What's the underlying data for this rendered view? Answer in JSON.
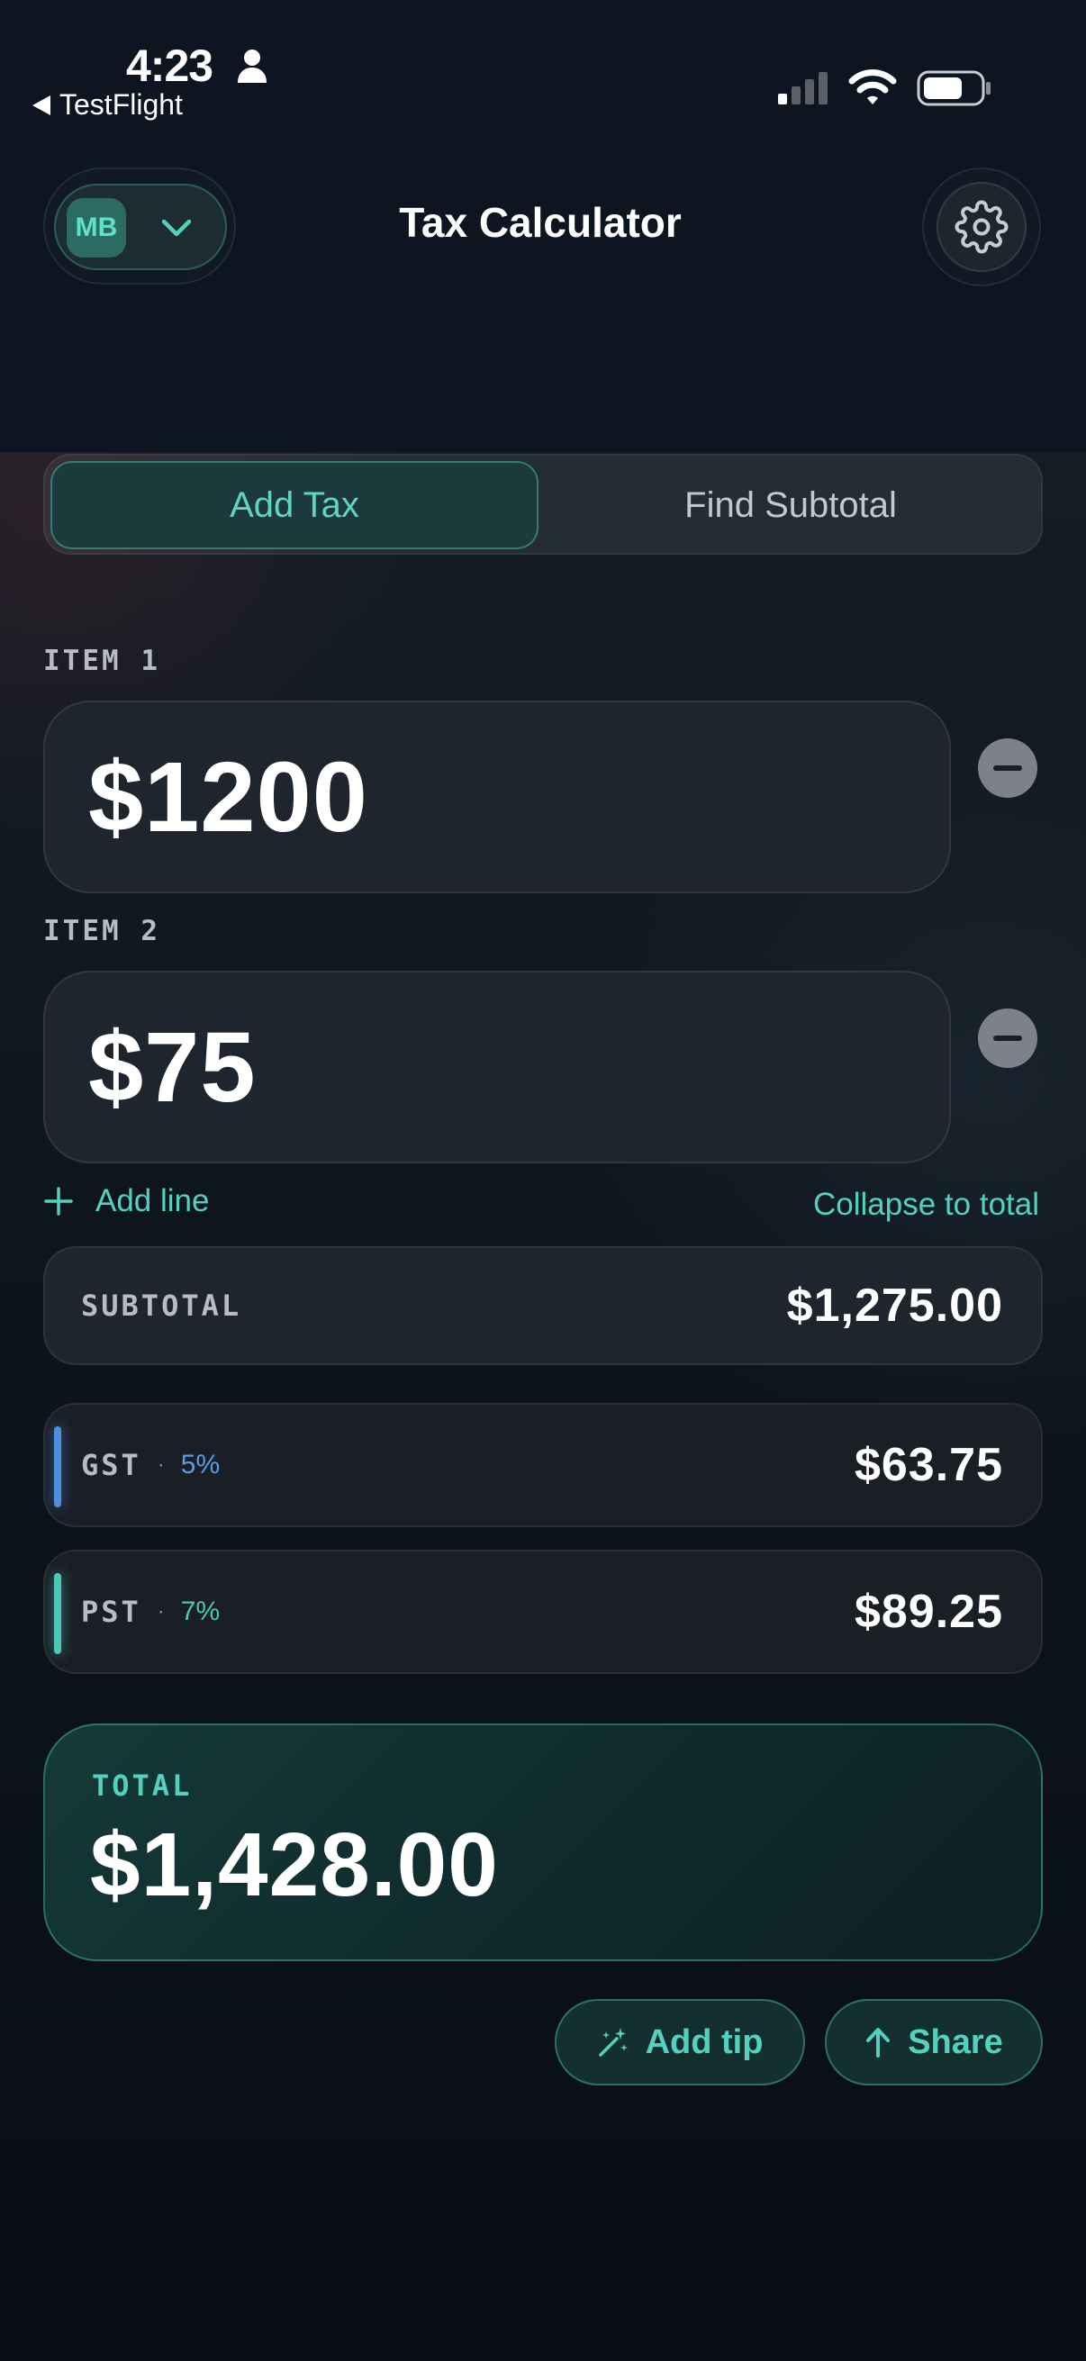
{
  "status_bar": {
    "time": "4:23",
    "back_label": "TestFlight"
  },
  "header": {
    "profile_initials": "MB",
    "title": "Tax Calculator"
  },
  "mode_tabs": [
    {
      "label": "Add Tax",
      "selected": true
    },
    {
      "label": "Find Subtotal",
      "selected": false
    }
  ],
  "items": [
    {
      "label": "ITEM 1",
      "amount": "$1200"
    },
    {
      "label": "ITEM 2",
      "amount": "$75"
    }
  ],
  "actions": {
    "add_line": "Add line",
    "collapse": "Collapse to total"
  },
  "subtotal": {
    "label": "SUBTOTAL",
    "value": "$1,275.00"
  },
  "taxes": [
    {
      "name": "GST",
      "separator": "·",
      "rate": "5%",
      "amount": "$63.75",
      "color": "#4f8fe0"
    },
    {
      "name": "PST",
      "separator": "·",
      "rate": "7%",
      "amount": "$89.25",
      "color": "#4cc8b4"
    }
  ],
  "total": {
    "label": "TOTAL",
    "value": "$1,428.00"
  },
  "buttons": {
    "add_tip": "Add tip",
    "share": "Share"
  },
  "colors": {
    "accent": "#54d0bf",
    "background": "#0b1118",
    "card": "#1f252d"
  }
}
